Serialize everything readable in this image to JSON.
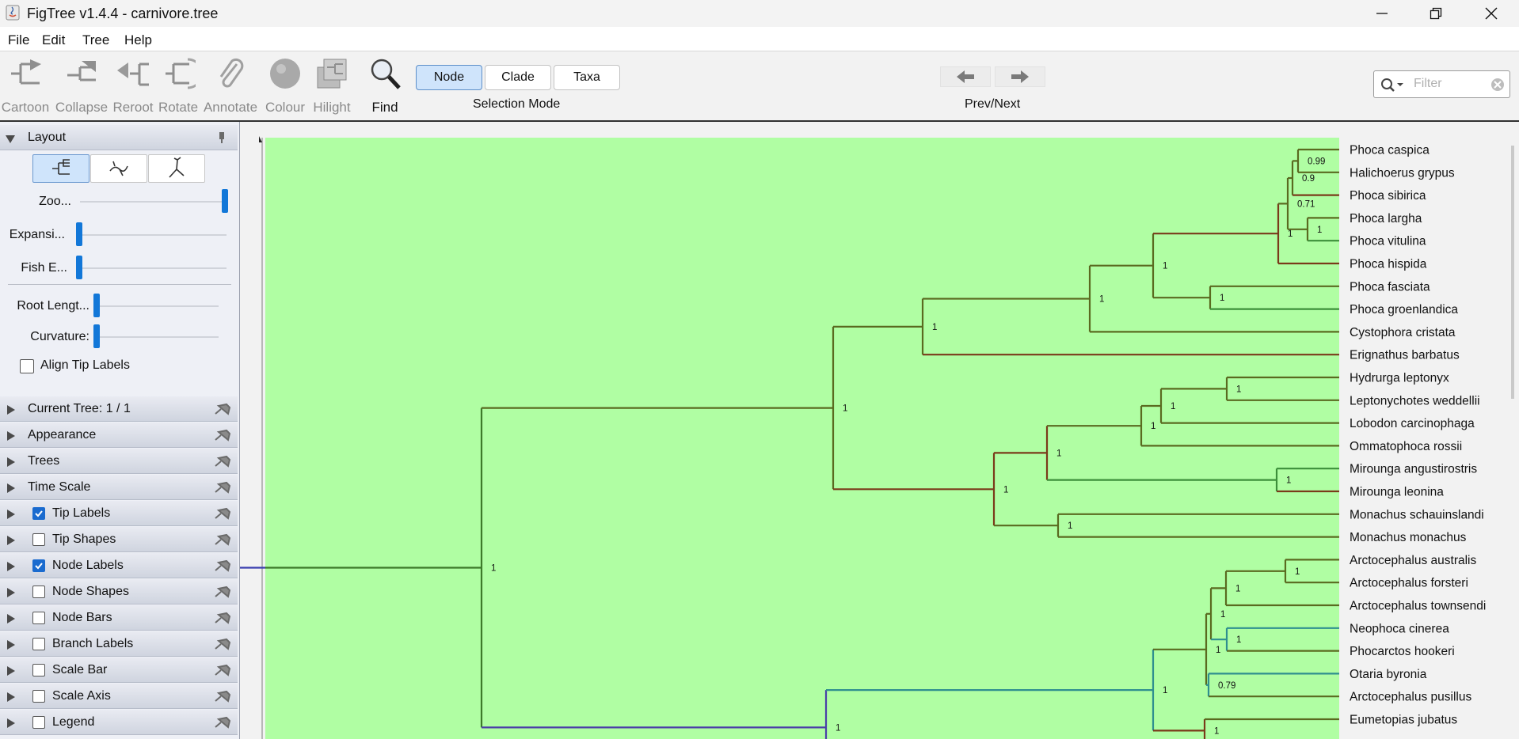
{
  "window": {
    "title": "FigTree v1.4.4 - carnivore.tree"
  },
  "menu": [
    "File",
    "Edit",
    "Tree",
    "Help"
  ],
  "toolbar": {
    "tools": [
      {
        "label": "Cartoon",
        "icon": "cartoon-icon",
        "enabled": false
      },
      {
        "label": "Collapse",
        "icon": "collapse-icon",
        "enabled": false
      },
      {
        "label": "Reroot",
        "icon": "reroot-icon",
        "enabled": false
      },
      {
        "label": "Rotate",
        "icon": "rotate-icon",
        "enabled": false
      },
      {
        "label": "Annotate",
        "icon": "paperclip-icon",
        "enabled": false
      },
      {
        "label": "Colour",
        "icon": "colour-icon",
        "enabled": false
      },
      {
        "label": "Hilight",
        "icon": "hilight-icon",
        "enabled": false
      },
      {
        "label": "Find",
        "icon": "magnifier-icon",
        "enabled": true
      }
    ],
    "selection_mode": {
      "options": [
        "Node",
        "Clade",
        "Taxa"
      ],
      "selected": "Node",
      "caption": "Selection Mode"
    },
    "prev_next_caption": "Prev/Next",
    "filter_placeholder": "Filter"
  },
  "panel": {
    "layout": {
      "title": "Layout",
      "sliders": [
        {
          "label": "Zoo...",
          "value": 1.0
        },
        {
          "label": "Expansi...",
          "value": 0.0
        },
        {
          "label": "Fish E...",
          "value": 0.0
        },
        {
          "label": "Root Lengt...",
          "value": 0.0
        },
        {
          "label": "Curvature:",
          "value": 0.0
        }
      ],
      "align_tip_labels": "Align Tip Labels"
    },
    "sections": [
      {
        "label": "Current Tree: 1 / 1",
        "checkbox": null
      },
      {
        "label": "Appearance",
        "checkbox": null
      },
      {
        "label": "Trees",
        "checkbox": null
      },
      {
        "label": "Time Scale",
        "checkbox": null
      },
      {
        "label": "Tip Labels",
        "checkbox": true
      },
      {
        "label": "Tip Shapes",
        "checkbox": false
      },
      {
        "label": "Node Labels",
        "checkbox": true
      },
      {
        "label": "Node Shapes",
        "checkbox": false
      },
      {
        "label": "Node Bars",
        "checkbox": false
      },
      {
        "label": "Branch Labels",
        "checkbox": false
      },
      {
        "label": "Scale Bar",
        "checkbox": false
      },
      {
        "label": "Scale Axis",
        "checkbox": false
      },
      {
        "label": "Legend",
        "checkbox": false
      }
    ]
  },
  "tree": {
    "selection_color": "#b0fea3",
    "tips": [
      "Phoca caspica",
      "Halichoerus grypus",
      "Phoca sibirica",
      "Phoca largha",
      "Phoca vitulina",
      "Phoca hispida",
      "Phoca fasciata",
      "Phoca groenlandica",
      "Cystophora cristata",
      "Erignathus barbatus",
      "Hydrurga leptonyx",
      "Leptonychotes weddellii",
      "Lobodon carcinophaga",
      "Ommatophoca rossii",
      "Mirounga angustirostris",
      "Mirounga leonina",
      "Monachus schauinslandi",
      "Monachus monachus",
      "Arctocephalus australis",
      "Arctocephalus forsteri",
      "Arctocephalus townsendi",
      "Neophoca cinerea",
      "Phocarctos hookeri",
      "Otaria byronia",
      "Arctocephalus pusillus",
      "Eumetopias jubatus"
    ],
    "node_labels": [
      "0.99",
      "0.9",
      "0.71",
      "1",
      "1",
      "1",
      "1",
      "1",
      "1",
      "1",
      "1",
      "1",
      "1",
      "1",
      "1",
      "1",
      "1",
      "1",
      "1",
      "1",
      "1",
      "1",
      "0.79",
      "1",
      "1",
      "1"
    ]
  }
}
